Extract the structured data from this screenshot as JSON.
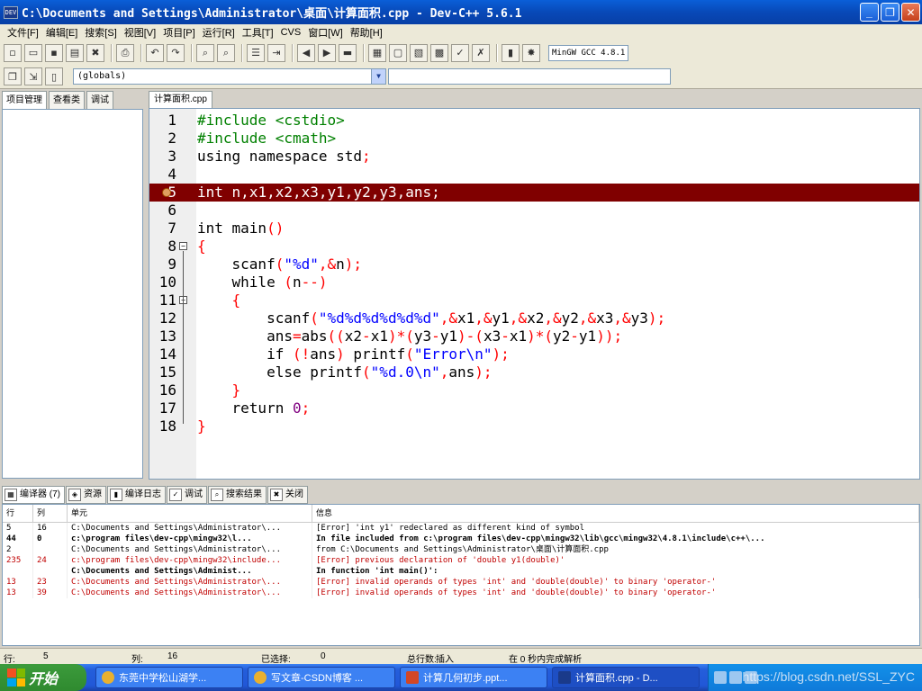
{
  "window": {
    "title": "C:\\Documents and Settings\\Administrator\\桌面\\计算面积.cpp - Dev-C++ 5.6.1",
    "app_icon": "DEV"
  },
  "menu": [
    "文件[F]",
    "编辑[E]",
    "搜索[S]",
    "视图[V]",
    "项目[P]",
    "运行[R]",
    "工具[T]",
    "CVS",
    "窗口[W]",
    "帮助[H]"
  ],
  "toolbar": {
    "compiler": "MinGW GCC 4.8.1",
    "scope": "(globals)"
  },
  "left_tabs": [
    "项目管理",
    "查看类",
    "调试"
  ],
  "editor_tab": "计算面积.cpp",
  "code_lines": [
    {
      "n": "1",
      "tokens": [
        [
          "pp",
          "#include <cstdio>"
        ]
      ]
    },
    {
      "n": "2",
      "tokens": [
        [
          "pp",
          "#include <cmath>"
        ]
      ]
    },
    {
      "n": "3",
      "tokens": [
        [
          "kw",
          "using namespace "
        ],
        [
          "id",
          "std"
        ],
        [
          "sym",
          ";"
        ]
      ]
    },
    {
      "n": "4",
      "tokens": []
    },
    {
      "n": "5",
      "highlight": true,
      "tokens": [
        [
          "kw",
          "int "
        ],
        [
          "id",
          "n"
        ],
        [
          "sym",
          ","
        ],
        [
          "id",
          "x1"
        ],
        [
          "sym",
          ","
        ],
        [
          "id",
          "x2"
        ],
        [
          "sym",
          ","
        ],
        [
          "id",
          "x3"
        ],
        [
          "sym",
          ","
        ],
        [
          "id",
          "y1"
        ],
        [
          "sym",
          ","
        ],
        [
          "id",
          "y2"
        ],
        [
          "sym",
          ","
        ],
        [
          "id",
          "y3"
        ],
        [
          "sym",
          ","
        ],
        [
          "id",
          "ans"
        ],
        [
          "sym",
          ";"
        ]
      ]
    },
    {
      "n": "6",
      "tokens": []
    },
    {
      "n": "7",
      "tokens": [
        [
          "kw",
          "int "
        ],
        [
          "id",
          "main"
        ],
        [
          "sym",
          "()"
        ]
      ]
    },
    {
      "n": "8",
      "tokens": [
        [
          "sym",
          "{"
        ]
      ]
    },
    {
      "n": "9",
      "tokens": [
        [
          "id",
          "    scanf"
        ],
        [
          "sym",
          "("
        ],
        [
          "str",
          "\"%d\""
        ],
        [
          "sym",
          ",&"
        ],
        [
          "id",
          "n"
        ],
        [
          "sym",
          ");"
        ]
      ]
    },
    {
      "n": "10",
      "tokens": [
        [
          "kw",
          "    while "
        ],
        [
          "sym",
          "("
        ],
        [
          "id",
          "n"
        ],
        [
          "sym",
          "--)"
        ]
      ]
    },
    {
      "n": "11",
      "tokens": [
        [
          "sym",
          "    {"
        ]
      ]
    },
    {
      "n": "12",
      "tokens": [
        [
          "id",
          "        scanf"
        ],
        [
          "sym",
          "("
        ],
        [
          "str",
          "\"%d%d%d%d%d%d\""
        ],
        [
          "sym",
          ",&"
        ],
        [
          "id",
          "x1"
        ],
        [
          "sym",
          ",&"
        ],
        [
          "id",
          "y1"
        ],
        [
          "sym",
          ",&"
        ],
        [
          "id",
          "x2"
        ],
        [
          "sym",
          ",&"
        ],
        [
          "id",
          "y2"
        ],
        [
          "sym",
          ",&"
        ],
        [
          "id",
          "x3"
        ],
        [
          "sym",
          ",&"
        ],
        [
          "id",
          "y3"
        ],
        [
          "sym",
          ");"
        ]
      ]
    },
    {
      "n": "13",
      "tokens": [
        [
          "id",
          "        ans"
        ],
        [
          "sym",
          "="
        ],
        [
          "id",
          "abs"
        ],
        [
          "sym",
          "(("
        ],
        [
          "id",
          "x2"
        ],
        [
          "sym",
          "-"
        ],
        [
          "id",
          "x1"
        ],
        [
          "sym",
          ")*("
        ],
        [
          "id",
          "y3"
        ],
        [
          "sym",
          "-"
        ],
        [
          "id",
          "y1"
        ],
        [
          "sym",
          ")-("
        ],
        [
          "id",
          "x3"
        ],
        [
          "sym",
          "-"
        ],
        [
          "id",
          "x1"
        ],
        [
          "sym",
          ")*("
        ],
        [
          "id",
          "y2"
        ],
        [
          "sym",
          "-"
        ],
        [
          "id",
          "y1"
        ],
        [
          "sym",
          "));"
        ]
      ]
    },
    {
      "n": "14",
      "tokens": [
        [
          "kw",
          "        if "
        ],
        [
          "sym",
          "(!"
        ],
        [
          "id",
          "ans"
        ],
        [
          "sym",
          ") "
        ],
        [
          "id",
          "printf"
        ],
        [
          "sym",
          "("
        ],
        [
          "str",
          "\"Error\\n\""
        ],
        [
          "sym",
          ");"
        ]
      ]
    },
    {
      "n": "15",
      "tokens": [
        [
          "kw",
          "        else "
        ],
        [
          "id",
          "printf"
        ],
        [
          "sym",
          "("
        ],
        [
          "str",
          "\"%d.0\\n\""
        ],
        [
          "sym",
          ","
        ],
        [
          "id",
          "ans"
        ],
        [
          "sym",
          ");"
        ]
      ]
    },
    {
      "n": "16",
      "tokens": [
        [
          "sym",
          "    }"
        ]
      ]
    },
    {
      "n": "17",
      "tokens": [
        [
          "kw",
          "    return "
        ],
        [
          "num",
          "0"
        ],
        [
          "sym",
          ";"
        ]
      ]
    },
    {
      "n": "18",
      "tokens": [
        [
          "sym",
          "}"
        ]
      ]
    }
  ],
  "bottom_tabs": [
    {
      "label": "编译器 (7)",
      "icon": "grid-icon"
    },
    {
      "label": "资源",
      "icon": "resource-icon"
    },
    {
      "label": "编译日志",
      "icon": "log-icon"
    },
    {
      "label": "调试",
      "icon": "check-icon"
    },
    {
      "label": "搜索结果",
      "icon": "search-icon"
    },
    {
      "label": "关闭",
      "icon": "close-icon"
    }
  ],
  "messages": {
    "headers": [
      "行",
      "列",
      "单元",
      "信息"
    ],
    "rows": [
      {
        "line": "5",
        "col": "16",
        "unit": "C:\\Documents and Settings\\Administrator\\...",
        "msg": "[Error] 'int y1' redeclared as different kind of symbol",
        "style": "normal"
      },
      {
        "line": "44",
        "col": "0",
        "unit": "c:\\program files\\dev-cpp\\mingw32\\l...",
        "msg": "In file included from c:\\program files\\dev-cpp\\mingw32\\lib\\gcc\\mingw32\\4.8.1\\include\\c++\\...",
        "style": "bold"
      },
      {
        "line": "2",
        "col": "",
        "unit": "C:\\Documents and Settings\\Administrator\\...",
        "msg": "                 from C:\\Documents and Settings\\Administrator\\桌面\\计算面积.cpp",
        "style": "normal"
      },
      {
        "line": "235",
        "col": "24",
        "unit": "c:\\program files\\dev-cpp\\mingw32\\include...",
        "msg": "[Error] previous declaration of 'double y1(double)'",
        "style": "err"
      },
      {
        "line": "",
        "col": "",
        "unit": "C:\\Documents and Settings\\Administ...",
        "msg": "In function 'int main()':",
        "style": "bold"
      },
      {
        "line": "13",
        "col": "23",
        "unit": "C:\\Documents and Settings\\Administrator\\...",
        "msg": "[Error] invalid operands of types 'int' and 'double(double)' to binary 'operator-'",
        "style": "err"
      },
      {
        "line": "13",
        "col": "39",
        "unit": "C:\\Documents and Settings\\Administrator\\...",
        "msg": "[Error] invalid operands of types 'int' and 'double(double)' to binary 'operator-'",
        "style": "err"
      }
    ]
  },
  "status": {
    "line_label": "行:",
    "line_val": "5",
    "col_label": "列:",
    "col_val": "16",
    "sel_label": "已选择:",
    "sel_val": "0",
    "total": "总行数:",
    "mode": "插入",
    "parse": "在 0 秒内完成解析"
  },
  "taskbar": {
    "start": "开始",
    "tasks": [
      "东莞中学松山湖学...",
      "写文章-CSDN博客 ...",
      "计算几何初步.ppt...",
      "计算面积.cpp - D..."
    ],
    "watermark": "https://blog.csdn.net/SSL_ZYC"
  },
  "colors": {
    "highlight_line": "#800000",
    "preprocessor": "#008000",
    "symbol": "#ff0000",
    "string": "#0000ff",
    "number": "#800080",
    "error_text": "#c00000"
  }
}
